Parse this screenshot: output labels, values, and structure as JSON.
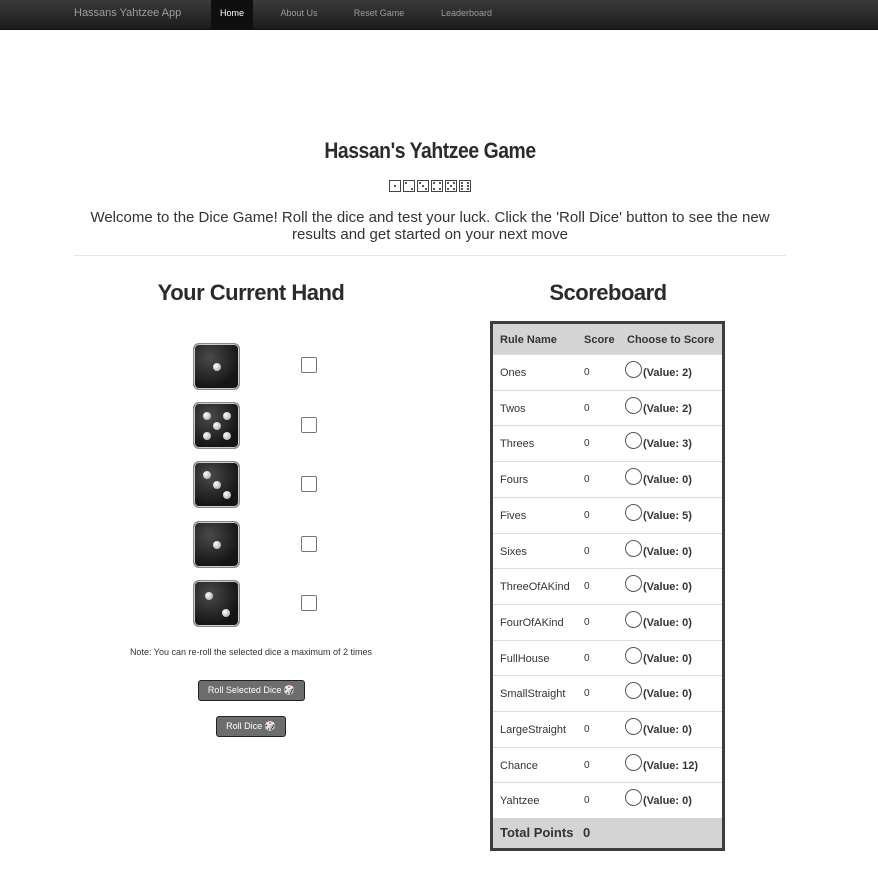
{
  "navbar": {
    "brand": "Hassans Yahtzee App",
    "items": [
      "Home",
      "About Us",
      "Reset Game",
      "Leaderboard"
    ]
  },
  "header": {
    "title": "Hassan's Yahtzee Game",
    "dice_strip": [
      "⚀",
      "⚁",
      "⚂",
      "⚃",
      "⚄",
      "⚅"
    ],
    "welcome": "Welcome to the Dice Game! Roll the dice and test your luck. Click the 'Roll Dice' button to see the new results and get started on your next move"
  },
  "hand": {
    "title": "Your Current Hand",
    "dice_values": [
      1,
      5,
      3,
      1,
      2
    ],
    "note": "Note: You can re-roll the selected dice a maximum of 2 times",
    "roll_selected_label": "Roll Selected Dice 🎲",
    "roll_label": "Roll Dice 🎲"
  },
  "scoreboard": {
    "title": "Scoreboard",
    "headers": [
      "Rule Name",
      "Score",
      "Choose to Score"
    ],
    "rows": [
      {
        "name": "Ones",
        "score": "0",
        "value": "(Value: 2)"
      },
      {
        "name": "Twos",
        "score": "0",
        "value": "(Value: 2)"
      },
      {
        "name": "Threes",
        "score": "0",
        "value": "(Value: 3)"
      },
      {
        "name": "Fours",
        "score": "0",
        "value": "(Value: 0)"
      },
      {
        "name": "Fives",
        "score": "0",
        "value": "(Value: 5)"
      },
      {
        "name": "Sixes",
        "score": "0",
        "value": "(Value: 0)"
      },
      {
        "name": "ThreeOfAKind",
        "score": "0",
        "value": "(Value: 0)"
      },
      {
        "name": "FourOfAKind",
        "score": "0",
        "value": "(Value: 0)"
      },
      {
        "name": "FullHouse",
        "score": "0",
        "value": "(Value: 0)"
      },
      {
        "name": "SmallStraight",
        "score": "0",
        "value": "(Value: 0)"
      },
      {
        "name": "LargeStraight",
        "score": "0",
        "value": "(Value: 0)"
      },
      {
        "name": "Chance",
        "score": "0",
        "value": "(Value: 12)"
      },
      {
        "name": "Yahtzee",
        "score": "0",
        "value": "(Value: 0)"
      }
    ],
    "total_label": "Total Points",
    "total_value": "0"
  }
}
